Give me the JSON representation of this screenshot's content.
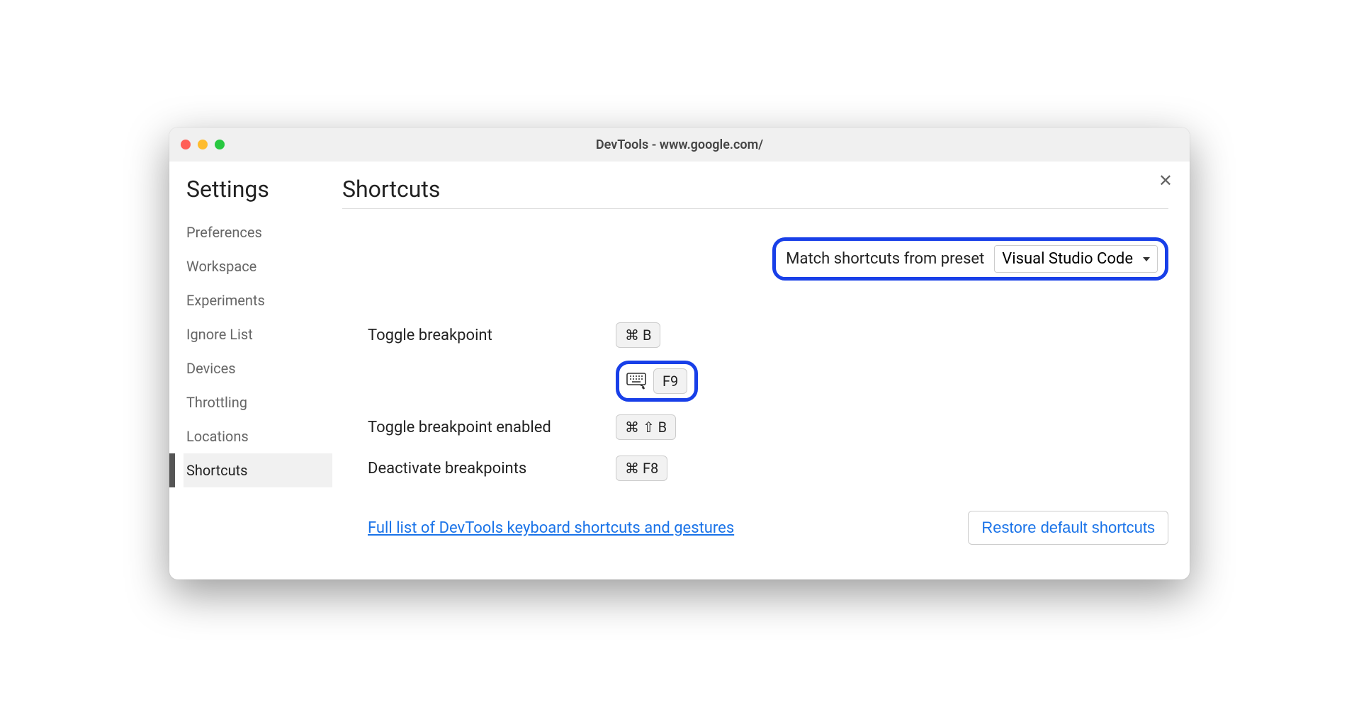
{
  "window": {
    "title": "DevTools - www.google.com/"
  },
  "sidebar": {
    "title": "Settings",
    "items": [
      {
        "label": "Preferences",
        "active": false
      },
      {
        "label": "Workspace",
        "active": false
      },
      {
        "label": "Experiments",
        "active": false
      },
      {
        "label": "Ignore List",
        "active": false
      },
      {
        "label": "Devices",
        "active": false
      },
      {
        "label": "Throttling",
        "active": false
      },
      {
        "label": "Locations",
        "active": false
      },
      {
        "label": "Shortcuts",
        "active": true
      }
    ]
  },
  "main": {
    "title": "Shortcuts",
    "preset": {
      "label": "Match shortcuts from preset",
      "selected": "Visual Studio Code"
    },
    "shortcuts": [
      {
        "label": "Toggle breakpoint",
        "keys": "⌘ B"
      },
      {
        "label": "",
        "keys": "F9",
        "keyboard_icon": true,
        "highlighted": true
      },
      {
        "label": "Toggle breakpoint enabled",
        "keys": "⌘ ⇧ B"
      },
      {
        "label": "Deactivate breakpoints",
        "keys": "⌘ F8"
      }
    ],
    "doc_link": "Full list of DevTools keyboard shortcuts and gestures",
    "restore_button": "Restore default shortcuts"
  }
}
